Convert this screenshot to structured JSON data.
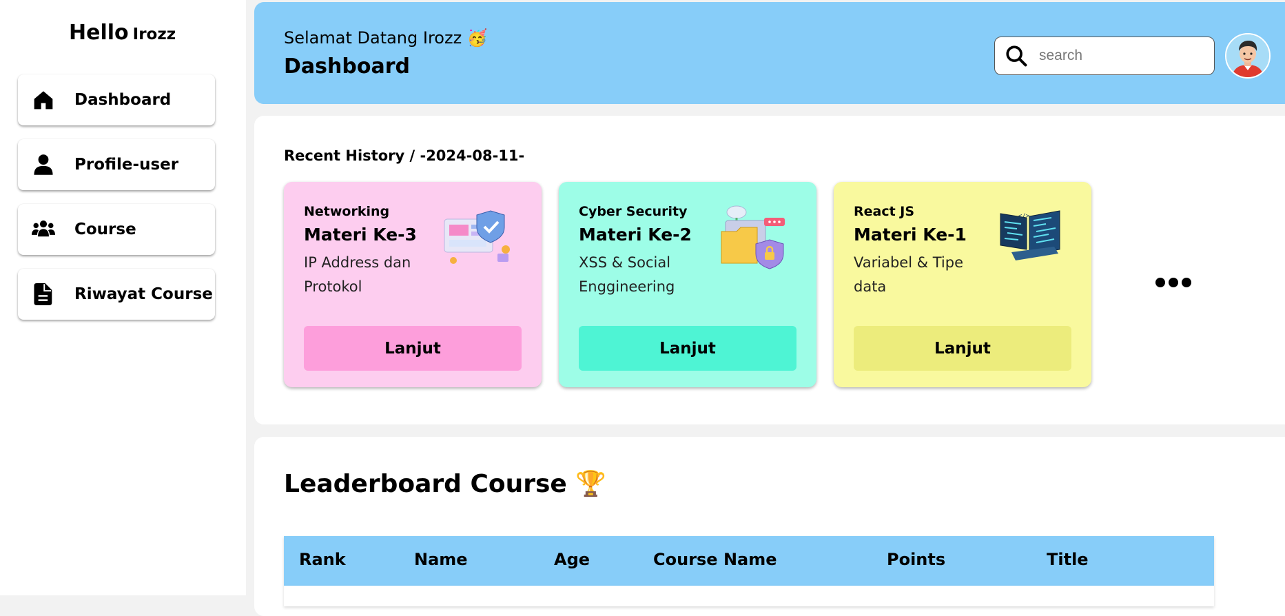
{
  "sidebar": {
    "greeting": "Hello",
    "username": "Irozz",
    "items": [
      {
        "label": "Dashboard",
        "icon": "home-icon"
      },
      {
        "label": "Profile-user",
        "icon": "user-icon"
      },
      {
        "label": "Course",
        "icon": "group-icon"
      },
      {
        "label": "Riwayat Course",
        "icon": "document-icon"
      }
    ]
  },
  "header": {
    "welcome": "Selamat Datang Irozz 🥳",
    "title": "Dashboard",
    "search_placeholder": "search",
    "accent_color": "#87cdf9"
  },
  "recent": {
    "title": "Recent History / -2024-08-11-",
    "cards": [
      {
        "course": "Networking",
        "materi": "Materi Ke-3",
        "desc": "IP Address dan Protokol",
        "button": "Lanjut",
        "bg": "#fdcdef",
        "button_bg": "#fd9edb",
        "illustration": "network-illustration"
      },
      {
        "course": "Cyber Security",
        "materi": "Materi Ke-2",
        "desc": "XSS & Social Enggineering",
        "button": "Lanjut",
        "bg": "#9dfde7",
        "button_bg": "#4ef4d4",
        "illustration": "security-illustration"
      },
      {
        "course": "React JS",
        "materi": "Materi Ke-1",
        "desc": "Variabel & Tipe data",
        "button": "Lanjut",
        "bg": "#f9f99e",
        "button_bg": "#ecec7c",
        "illustration": "code-illustration"
      }
    ],
    "more_icon": "more-dots-icon"
  },
  "leaderboard": {
    "title": "Leaderboard Course 🏆",
    "columns": [
      "Rank",
      "Name",
      "Age",
      "Course Name",
      "Points",
      "Title"
    ]
  }
}
